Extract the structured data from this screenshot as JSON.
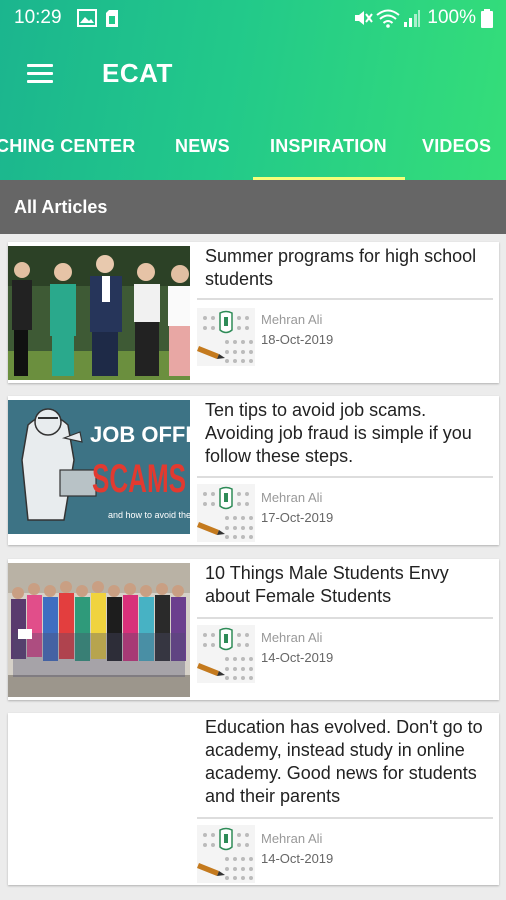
{
  "status_bar": {
    "time": "10:29",
    "battery": "100%",
    "icons": [
      "gallery-icon",
      "sim-icon",
      "mute-icon",
      "wifi-icon",
      "signal-icon",
      "battery-icon"
    ]
  },
  "toolbar": {
    "title": "ECAT",
    "menu_icon": "hamburger-menu-icon"
  },
  "tabs": [
    {
      "label": "CHING CENTER",
      "selected": false
    },
    {
      "label": "NEWS",
      "selected": false
    },
    {
      "label": "INSPIRATION",
      "selected": true
    },
    {
      "label": "VIDEOS",
      "selected": false
    }
  ],
  "section": {
    "title": "All Articles"
  },
  "articles": [
    {
      "title": "Summer programs for high school students",
      "author": "Mehran Ali",
      "date": "18-Oct-2019",
      "image": "group-photo"
    },
    {
      "title": "Ten tips to avoid job scams. Avoiding job fraud is simple if you follow these steps.",
      "author": "Mehran Ali",
      "date": "17-Oct-2019",
      "image": "job-offer-scams-poster",
      "poster_text": [
        "JOB OFFER",
        "SCAMS",
        "and how to avoid them."
      ]
    },
    {
      "title": "10 Things Male Students Envy about Female Students",
      "author": "Mehran Ali",
      "date": "14-Oct-2019",
      "image": "female-students-group"
    },
    {
      "title": "Education has evolved. Don't go to academy, instead study in online academy. Good news for students and their parents",
      "author": "Mehran Ali",
      "date": "14-Oct-2019",
      "image": "blank"
    }
  ],
  "colors": {
    "appbar_start": "#1bb58e",
    "appbar_end": "#35de79",
    "tab_indicator": "#f5ff7a",
    "section_bg": "#666666"
  }
}
